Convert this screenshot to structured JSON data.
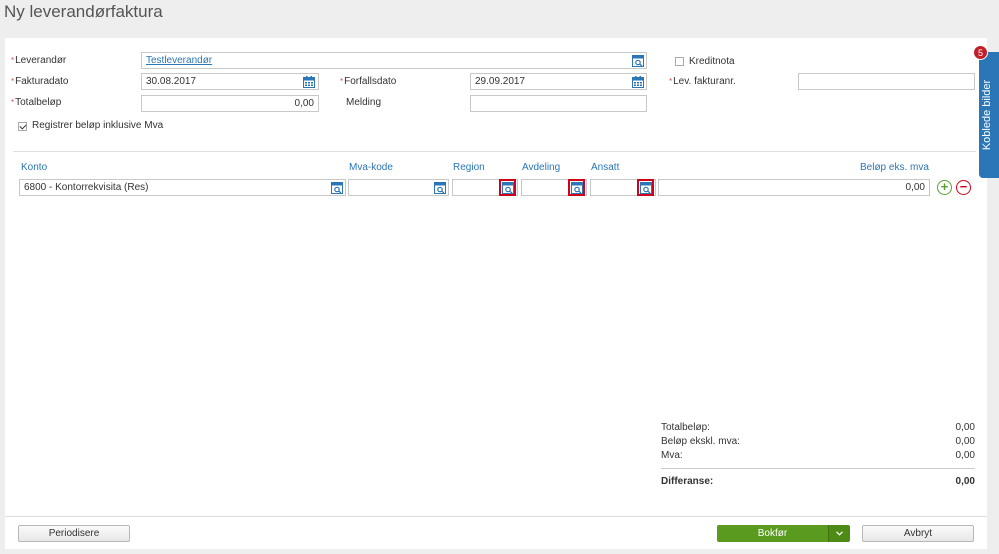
{
  "page": {
    "title": "Ny leverandørfaktura"
  },
  "form": {
    "required_mark": "*",
    "leverandor": {
      "label": "Leverandør",
      "value": "Testleverandør"
    },
    "kreditnota": {
      "label": "Kreditnota",
      "checked": false
    },
    "fakturadato": {
      "label": "Fakturadato",
      "value": "30.08.2017"
    },
    "forfallsdato": {
      "label": "Forfallsdato",
      "value": "29.09.2017"
    },
    "lev_fakturanr": {
      "label": "Lev. fakturanr.",
      "value": ""
    },
    "totalbelop": {
      "label": "Totalbeløp",
      "value": "0,00"
    },
    "melding": {
      "label": "Melding",
      "value": ""
    },
    "inkl_mva": {
      "label": "Registrer beløp inklusive Mva",
      "checked": true
    }
  },
  "table": {
    "headers": {
      "konto": "Konto",
      "mva_kode": "Mva-kode",
      "region": "Region",
      "avdeling": "Avdeling",
      "ansatt": "Ansatt",
      "belop": "Beløp eks. mva"
    },
    "rows": [
      {
        "konto": "6800 - Kontorrekvisita (Res)",
        "mva_kode": "",
        "region": "",
        "avdeling": "",
        "ansatt": "",
        "belop": "0,00"
      }
    ],
    "add_symbol": "+",
    "remove_symbol": "−"
  },
  "summary": {
    "totalbelop": {
      "label": "Totalbeløp:",
      "value": "0,00"
    },
    "ekskl_mva": {
      "label": "Beløp ekskl. mva:",
      "value": "0,00"
    },
    "mva": {
      "label": "Mva:",
      "value": "0,00"
    },
    "differanse": {
      "label": "Differanse:",
      "value": "0,00"
    }
  },
  "footer": {
    "periodisere": "Periodisere",
    "bokfor": "Bokfør",
    "avbryt": "Avbryt"
  },
  "side_tab": {
    "label": "Koblede bilder",
    "badge": "5"
  },
  "colors": {
    "accent": "#2a76b6",
    "primary": "#5a9a1e",
    "danger": "#d0021b"
  },
  "icons": [
    "lookup-icon",
    "calendar-icon",
    "chevron-down-icon",
    "plus-icon",
    "minus-icon"
  ]
}
